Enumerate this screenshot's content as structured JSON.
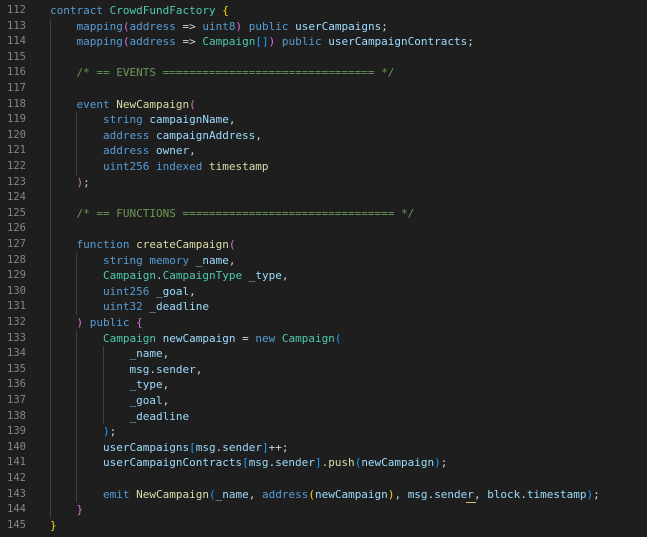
{
  "editor": {
    "language": "solidity",
    "lines": [
      {
        "n": "112",
        "tokens": [
          [
            "k",
            "contract "
          ],
          [
            "t",
            "CrowdFundFactory "
          ],
          [
            "b1",
            "{"
          ]
        ]
      },
      {
        "n": "113",
        "tokens": [
          [
            "p",
            "    "
          ],
          [
            "k",
            "mapping"
          ],
          [
            "b2",
            "("
          ],
          [
            "k",
            "address"
          ],
          [
            "p",
            " => "
          ],
          [
            "k",
            "uint8"
          ],
          [
            "b2",
            ")"
          ],
          [
            "p",
            " "
          ],
          [
            "k",
            "public"
          ],
          [
            "p",
            " "
          ],
          [
            "v",
            "userCampaigns"
          ],
          [
            "p",
            ";"
          ]
        ]
      },
      {
        "n": "114",
        "tokens": [
          [
            "p",
            "    "
          ],
          [
            "k",
            "mapping"
          ],
          [
            "b2",
            "("
          ],
          [
            "k",
            "address"
          ],
          [
            "p",
            " => "
          ],
          [
            "t",
            "Campaign"
          ],
          [
            "b3",
            "[]"
          ],
          [
            "b2",
            ")"
          ],
          [
            "p",
            " "
          ],
          [
            "k",
            "public"
          ],
          [
            "p",
            " "
          ],
          [
            "v",
            "userCampaignContracts"
          ],
          [
            "p",
            ";"
          ]
        ]
      },
      {
        "n": "115",
        "tokens": []
      },
      {
        "n": "116",
        "tokens": [
          [
            "p",
            "    "
          ],
          [
            "c",
            "/* == EVENTS ================================ */"
          ]
        ]
      },
      {
        "n": "117",
        "tokens": []
      },
      {
        "n": "118",
        "tokens": [
          [
            "p",
            "    "
          ],
          [
            "k",
            "event"
          ],
          [
            "p",
            " "
          ],
          [
            "f",
            "NewCampaign"
          ],
          [
            "b2",
            "("
          ]
        ]
      },
      {
        "n": "119",
        "tokens": [
          [
            "p",
            "        "
          ],
          [
            "k",
            "string"
          ],
          [
            "p",
            " "
          ],
          [
            "v",
            "campaignName"
          ],
          [
            "p",
            ","
          ]
        ]
      },
      {
        "n": "120",
        "tokens": [
          [
            "p",
            "        "
          ],
          [
            "k",
            "address"
          ],
          [
            "p",
            " "
          ],
          [
            "v",
            "campaignAddress"
          ],
          [
            "p",
            ","
          ]
        ]
      },
      {
        "n": "121",
        "tokens": [
          [
            "p",
            "        "
          ],
          [
            "k",
            "address"
          ],
          [
            "p",
            " "
          ],
          [
            "v",
            "owner"
          ],
          [
            "p",
            ","
          ]
        ]
      },
      {
        "n": "122",
        "tokens": [
          [
            "p",
            "        "
          ],
          [
            "k",
            "uint256"
          ],
          [
            "p",
            " "
          ],
          [
            "k",
            "indexed"
          ],
          [
            "p",
            " "
          ],
          [
            "f",
            "timestamp"
          ]
        ]
      },
      {
        "n": "123",
        "tokens": [
          [
            "p",
            "    "
          ],
          [
            "b2",
            ")"
          ],
          [
            "p",
            ";"
          ]
        ]
      },
      {
        "n": "124",
        "tokens": []
      },
      {
        "n": "125",
        "tokens": [
          [
            "p",
            "    "
          ],
          [
            "c",
            "/* == FUNCTIONS ================================ */"
          ]
        ]
      },
      {
        "n": "126",
        "tokens": []
      },
      {
        "n": "127",
        "tokens": [
          [
            "p",
            "    "
          ],
          [
            "k",
            "function"
          ],
          [
            "p",
            " "
          ],
          [
            "f",
            "createCampaign"
          ],
          [
            "b2",
            "("
          ]
        ]
      },
      {
        "n": "128",
        "tokens": [
          [
            "p",
            "        "
          ],
          [
            "k",
            "string"
          ],
          [
            "p",
            " "
          ],
          [
            "k",
            "memory"
          ],
          [
            "p",
            " "
          ],
          [
            "v",
            "_name"
          ],
          [
            "p",
            ","
          ]
        ]
      },
      {
        "n": "129",
        "tokens": [
          [
            "p",
            "        "
          ],
          [
            "t",
            "Campaign"
          ],
          [
            "p",
            "."
          ],
          [
            "t",
            "CampaignType"
          ],
          [
            "p",
            " "
          ],
          [
            "v",
            "_type"
          ],
          [
            "p",
            ","
          ]
        ]
      },
      {
        "n": "130",
        "tokens": [
          [
            "p",
            "        "
          ],
          [
            "k",
            "uint256"
          ],
          [
            "p",
            " "
          ],
          [
            "v",
            "_goal"
          ],
          [
            "p",
            ","
          ]
        ]
      },
      {
        "n": "131",
        "tokens": [
          [
            "p",
            "        "
          ],
          [
            "k",
            "uint32"
          ],
          [
            "p",
            " "
          ],
          [
            "v",
            "_deadline"
          ]
        ]
      },
      {
        "n": "132",
        "tokens": [
          [
            "p",
            "    "
          ],
          [
            "b2",
            ")"
          ],
          [
            "p",
            " "
          ],
          [
            "k",
            "public"
          ],
          [
            "p",
            " "
          ],
          [
            "b2",
            "{"
          ]
        ]
      },
      {
        "n": "133",
        "tokens": [
          [
            "p",
            "        "
          ],
          [
            "t",
            "Campaign"
          ],
          [
            "p",
            " "
          ],
          [
            "v",
            "newCampaign"
          ],
          [
            "p",
            " = "
          ],
          [
            "k",
            "new"
          ],
          [
            "p",
            " "
          ],
          [
            "t",
            "Campaign"
          ],
          [
            "b3",
            "("
          ]
        ]
      },
      {
        "n": "134",
        "tokens": [
          [
            "p",
            "            "
          ],
          [
            "v",
            "_name"
          ],
          [
            "p",
            ","
          ]
        ]
      },
      {
        "n": "135",
        "tokens": [
          [
            "p",
            "            "
          ],
          [
            "v",
            "msg"
          ],
          [
            "p",
            "."
          ],
          [
            "v",
            "sender"
          ],
          [
            "p",
            ","
          ]
        ]
      },
      {
        "n": "136",
        "tokens": [
          [
            "p",
            "            "
          ],
          [
            "v",
            "_type"
          ],
          [
            "p",
            ","
          ]
        ]
      },
      {
        "n": "137",
        "tokens": [
          [
            "p",
            "            "
          ],
          [
            "v",
            "_goal"
          ],
          [
            "p",
            ","
          ]
        ]
      },
      {
        "n": "138",
        "tokens": [
          [
            "p",
            "            "
          ],
          [
            "v",
            "_deadline"
          ]
        ]
      },
      {
        "n": "139",
        "tokens": [
          [
            "p",
            "        "
          ],
          [
            "b3",
            ")"
          ],
          [
            "p",
            ";"
          ]
        ]
      },
      {
        "n": "140",
        "tokens": [
          [
            "p",
            "        "
          ],
          [
            "v",
            "userCampaigns"
          ],
          [
            "b3",
            "["
          ],
          [
            "v",
            "msg"
          ],
          [
            "p",
            "."
          ],
          [
            "v",
            "sender"
          ],
          [
            "b3",
            "]"
          ],
          [
            "p",
            "++;"
          ]
        ]
      },
      {
        "n": "141",
        "tokens": [
          [
            "p",
            "        "
          ],
          [
            "v",
            "userCampaignContracts"
          ],
          [
            "b3",
            "["
          ],
          [
            "v",
            "msg"
          ],
          [
            "p",
            "."
          ],
          [
            "v",
            "sender"
          ],
          [
            "b3",
            "]"
          ],
          [
            "p",
            "."
          ],
          [
            "f",
            "push"
          ],
          [
            "b3",
            "("
          ],
          [
            "v",
            "newCampaign"
          ],
          [
            "b3",
            ")"
          ],
          [
            "p",
            ";"
          ]
        ]
      },
      {
        "n": "142",
        "tokens": []
      },
      {
        "n": "143",
        "tokens": [
          [
            "p",
            "        "
          ],
          [
            "k",
            "emit"
          ],
          [
            "p",
            " "
          ],
          [
            "f",
            "NewCampaign"
          ],
          [
            "b3",
            "("
          ],
          [
            "v",
            "_name"
          ],
          [
            "p",
            ", "
          ],
          [
            "k",
            "address"
          ],
          [
            "b1",
            "("
          ],
          [
            "v",
            "newCampaign"
          ],
          [
            "b1",
            ")"
          ],
          [
            "p",
            ", "
          ],
          [
            "v",
            "msg"
          ],
          [
            "p",
            "."
          ],
          [
            "v",
            "sender"
          ],
          [
            "p",
            ", "
          ],
          [
            "v",
            "block"
          ],
          [
            "p",
            "."
          ],
          [
            "v",
            "timestamp"
          ],
          [
            "b3",
            ")"
          ],
          [
            "p",
            ";"
          ]
        ]
      },
      {
        "n": "144",
        "tokens": [
          [
            "p",
            "    "
          ],
          [
            "b2",
            "}"
          ]
        ]
      },
      {
        "n": "145",
        "tokens": [
          [
            "b1",
            "}"
          ]
        ]
      }
    ]
  }
}
